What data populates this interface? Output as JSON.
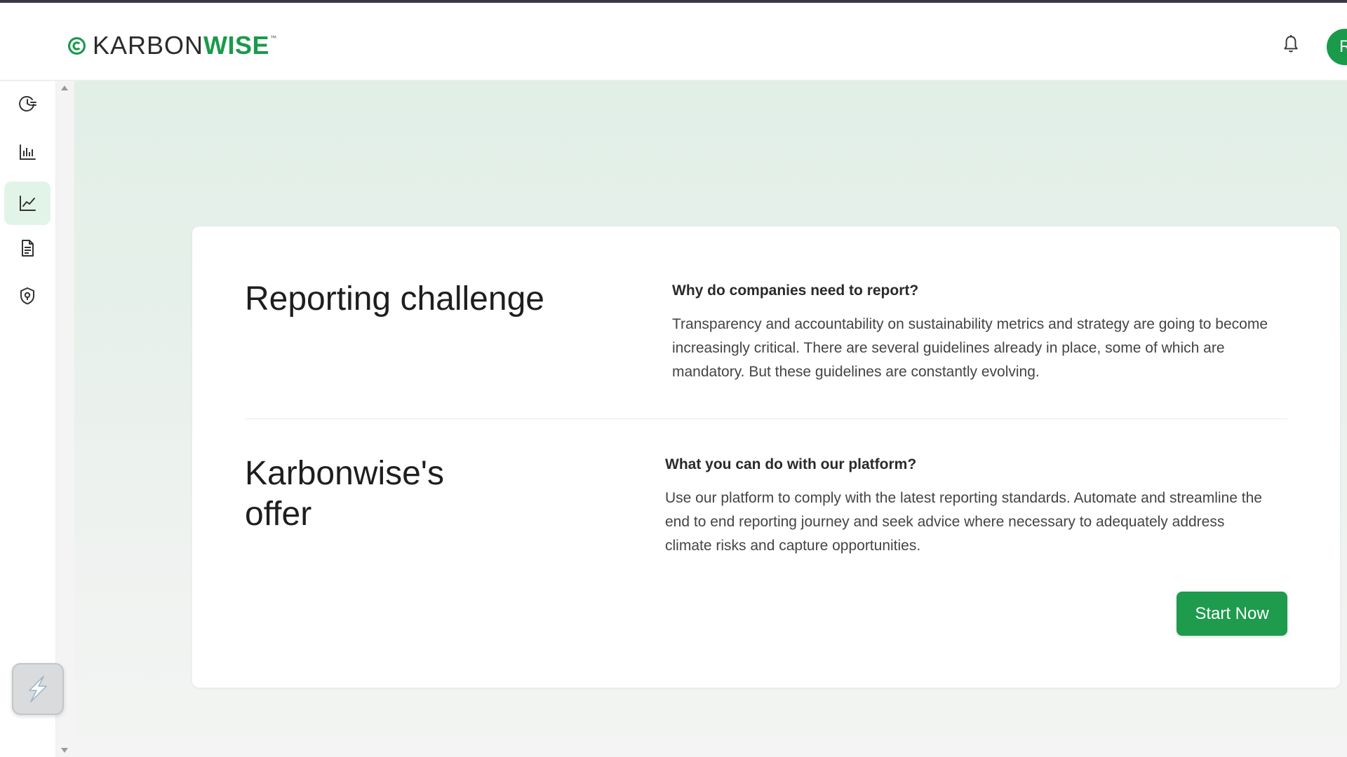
{
  "brand": {
    "name_prefix": "KARBON",
    "name_suffix": "WISE",
    "trademark": "™",
    "color": "#1a9a4b"
  },
  "header": {
    "notification_icon": "bell-icon",
    "avatar_initial": "R"
  },
  "sidebar": {
    "items": [
      {
        "icon": "history-clock-icon",
        "active": false
      },
      {
        "icon": "bar-chart-icon",
        "active": false
      },
      {
        "icon": "line-chart-icon",
        "active": true
      },
      {
        "icon": "document-icon",
        "active": false
      },
      {
        "icon": "shield-icon",
        "active": false
      }
    ],
    "extension_icon": "lightning-extension-icon"
  },
  "content": {
    "section1": {
      "title": "Reporting challenge",
      "question": "Why do companies need to report?",
      "body": "Transparency and accountability on sustainability metrics and strategy are going to become increasingly critical. There are several guidelines already in place, some of which are mandatory. But these guidelines are constantly evolving."
    },
    "section2": {
      "title": "Karbonwise's offer",
      "question": "What you can do with our platform?",
      "body": "Use our platform to comply with the latest reporting standards. Automate and streamline the end to end reporting journey and seek advice where necessary to adequately address climate risks and capture opportunities."
    },
    "cta_label": "Start Now"
  },
  "colors": {
    "accent": "#1e9b4c",
    "active_nav_bg": "#e2f4e8",
    "main_bg_top": "#e1efe7"
  }
}
